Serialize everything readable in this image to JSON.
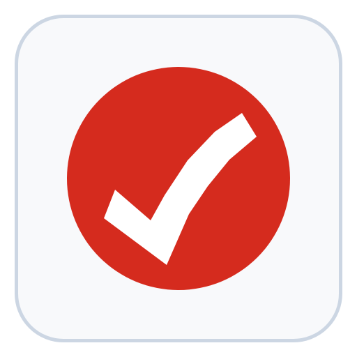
{
  "app_icon": {
    "icon": "checkmark-icon",
    "colors": {
      "tile_background": "#f8f9fb",
      "tile_border": "#ccd6e3",
      "badge": "#d52b1e",
      "checkmark": "#ffffff"
    }
  }
}
